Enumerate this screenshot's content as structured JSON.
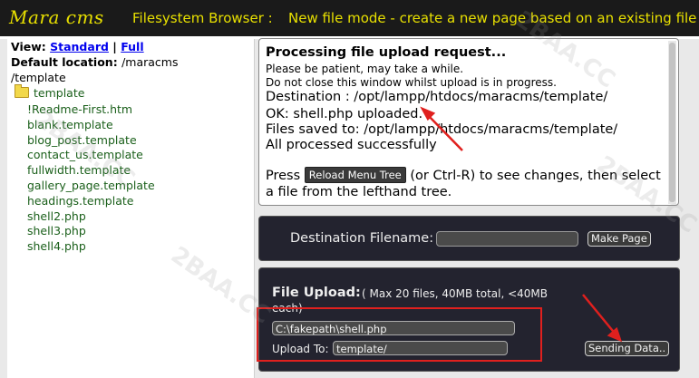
{
  "header": {
    "logo": "Mara cms",
    "title": "Filesystem Browser :",
    "mode": "New file mode - create a new page based on an existing file"
  },
  "sidebar": {
    "view_label": "View:",
    "view_standard": "Standard",
    "view_separator": "|",
    "view_full": "Full",
    "default_location_label": "Default location:",
    "default_location_value": "/maracms",
    "default_location_cont": "/template",
    "folder": "template",
    "files": [
      "!Readme-First.htm",
      "blank.template",
      "blog_post.template",
      "contact_us.template",
      "fullwidth.template",
      "gallery_page.template",
      "headings.template",
      "shell2.php",
      "shell3.php",
      "shell4.php"
    ]
  },
  "status_panel": {
    "title": "Processing file upload request...",
    "line1": "Please be patient, may take a while.",
    "line2": "Do not close this window whilst upload is in progress.",
    "destination": "Destination : /opt/lampp/htdocs/maracms/template/",
    "ok": "OK: shell.php uploaded.",
    "saved": "Files saved to: /opt/lampp/htdocs/maracms/template/",
    "processed": "All processed successfully",
    "press_pre": "Press",
    "reload_button": "Reload Menu Tree",
    "press_post": "(or Ctrl-R) to see changes, then select",
    "press_line2": "a file from the lefthand tree."
  },
  "destination": {
    "label": "Destination Filename:",
    "value": "",
    "button": "Make Page"
  },
  "upload": {
    "title": "File Upload:",
    "desc": "( Max 20 files, 40MB total, <40MB",
    "desc2": "each)",
    "file_value": "C:\\fakepath\\shell.php",
    "upload_to_label": "Upload To:",
    "upload_to_value": "template/",
    "button": "Sending Data.."
  },
  "colors": {
    "header_bg": "#1a1a1a",
    "header_text": "#e8e000",
    "annotation_red": "#e0201e",
    "dark_panel": "#23232f",
    "link_blue": "#0000ee",
    "tree_green": "#1a5f1a"
  }
}
